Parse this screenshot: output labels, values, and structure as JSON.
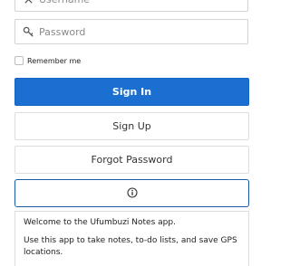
{
  "login_form": {
    "username": {
      "placeholder": "Username",
      "value": "",
      "icon": "user-icon"
    },
    "password": {
      "placeholder": "Password",
      "value": "",
      "icon": "key-icon"
    },
    "remember_me": {
      "label": "Remember me",
      "checked": false
    }
  },
  "buttons": {
    "sign_in": "Sign In",
    "sign_up": "Sign Up",
    "forgot_password": "Forgot Password",
    "info_icon": "info-icon"
  },
  "welcome_panel": {
    "line1": "Welcome to the Ufumbuzi Notes app.",
    "line2": "Use this app to take notes, to-do lists, and save GPS locations."
  },
  "colors": {
    "primary": "#1a6fd0",
    "info_border": "#1a5aa8",
    "field_border": "#d3d3d3"
  }
}
